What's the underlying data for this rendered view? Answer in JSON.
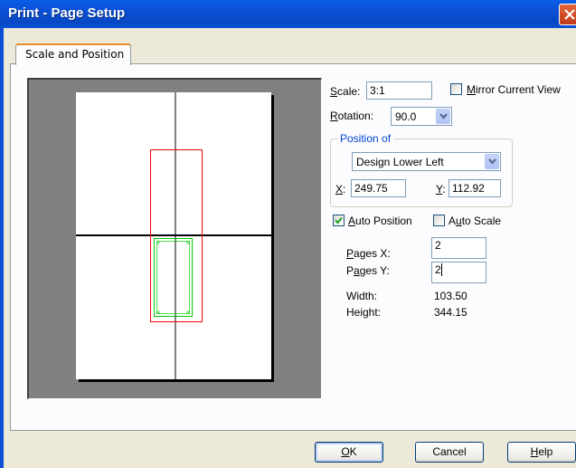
{
  "window": {
    "title": "Print - Page Setup"
  },
  "tabs": [
    {
      "label": "Scale and Position"
    }
  ],
  "scale": {
    "label": "Scale:",
    "mnemonic": "S",
    "label_rest": "cale:",
    "value": "3:1"
  },
  "mirror": {
    "label_m": "M",
    "label_rest": "irror Current View",
    "checked": false
  },
  "rotation": {
    "label_r": "R",
    "label_rest": "otation:",
    "value": "90.0"
  },
  "position_of": {
    "title": "Position of",
    "selected": "Design Lower Left",
    "x_label_u": "X",
    "x_label_rest": ":",
    "x_value": "249.75",
    "y_label_u": "Y",
    "y_label_rest": ":",
    "y_value": "112.92"
  },
  "auto_position": {
    "label_a": "A",
    "label_rest": "uto Position",
    "checked": true
  },
  "auto_scale": {
    "label_pre": "A",
    "label_u": "u",
    "label_rest": "to Scale",
    "checked": false
  },
  "pages_x": {
    "label_u": "P",
    "label_rest": "ages X:",
    "value": "2"
  },
  "pages_y": {
    "label_pre": "P",
    "label_u": "a",
    "label_rest": "ges Y:",
    "value": "2"
  },
  "width": {
    "label": "Width:",
    "value": "103.50"
  },
  "height": {
    "label": "Height:",
    "value": "344.15"
  },
  "buttons": {
    "ok": {
      "label_u": "O",
      "label_rest": "K"
    },
    "cancel": {
      "label": "Cancel"
    },
    "help": {
      "label_u": "H",
      "label_rest": "elp"
    }
  },
  "colors": {
    "title_bar": "#0a4fd4",
    "print_area": "#ff0000",
    "design_outline": "#00cc00",
    "group_title": "#0046d5"
  }
}
